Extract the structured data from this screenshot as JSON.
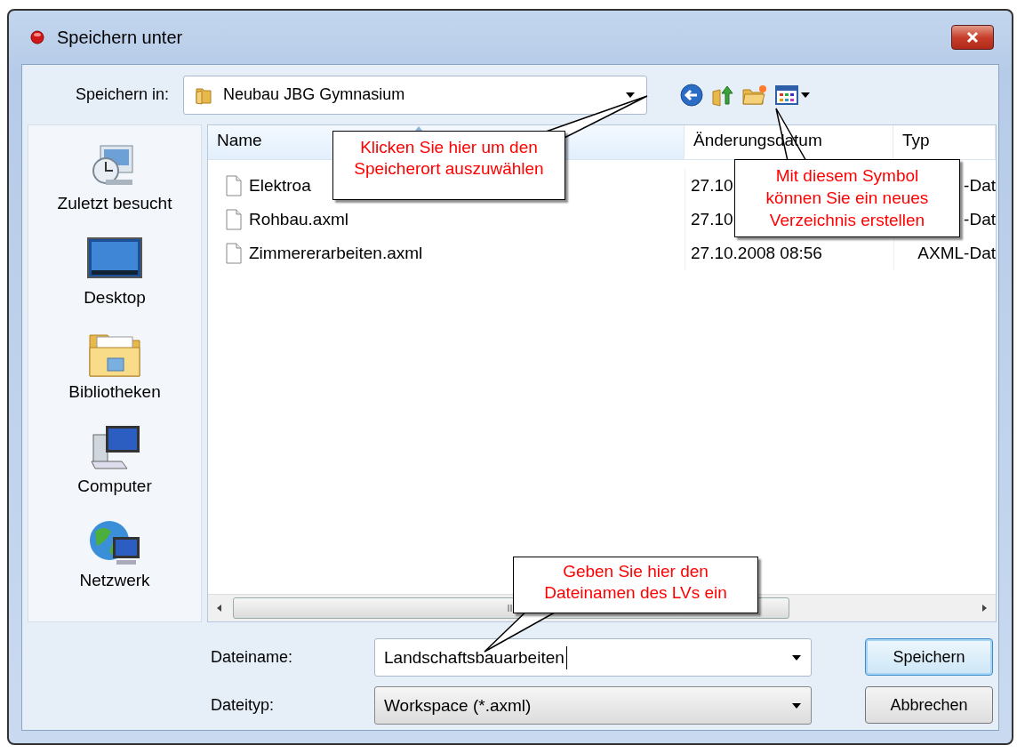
{
  "window": {
    "title": "Speichern unter"
  },
  "location": {
    "label": "Speichern in:",
    "value": "Neubau JBG Gymnasium"
  },
  "places": [
    {
      "kind": "recent",
      "label": "Zuletzt besucht",
      "selected": false
    },
    {
      "kind": "desktop",
      "label": "Desktop",
      "selected": false
    },
    {
      "kind": "libraries",
      "label": "Bibliotheken",
      "selected": false
    },
    {
      "kind": "computer",
      "label": "Computer",
      "selected": false
    },
    {
      "kind": "network",
      "label": "Netzwerk",
      "selected": false
    }
  ],
  "file_list": {
    "columns": [
      {
        "label": "Name",
        "sorted": true
      },
      {
        "label": "Änderungsdatum",
        "sorted": false
      },
      {
        "label": "Typ",
        "sorted": false
      }
    ],
    "rows": [
      {
        "name": "Elektroa",
        "date": "27.10",
        "type": "-Dat"
      },
      {
        "name": "Rohbau.axml",
        "date": "27.10",
        "type": "-Dat"
      },
      {
        "name": "Zimmererarbeiten.axml",
        "date": "27.10.2008 08:56",
        "type": "AXML-Dat"
      }
    ]
  },
  "filename": {
    "label": "Dateiname:",
    "value": "Landschaftsbauarbeiten"
  },
  "filetype": {
    "label": "Dateityp:",
    "value": "Workspace (*.axml)"
  },
  "buttons": [
    {
      "label": "Speichern",
      "default": true
    },
    {
      "label": "Abbrechen",
      "default": false
    }
  ],
  "callouts": [
    {
      "text": "Klicken Sie hier um den\nSpeicherort auszuwählen"
    },
    {
      "text": "Mit diesem Symbol\nkönnen Sie ein neues\nVerzeichnis erstellen"
    },
    {
      "text": "Geben Sie hier den\nDateinamen des LVs ein"
    }
  ]
}
